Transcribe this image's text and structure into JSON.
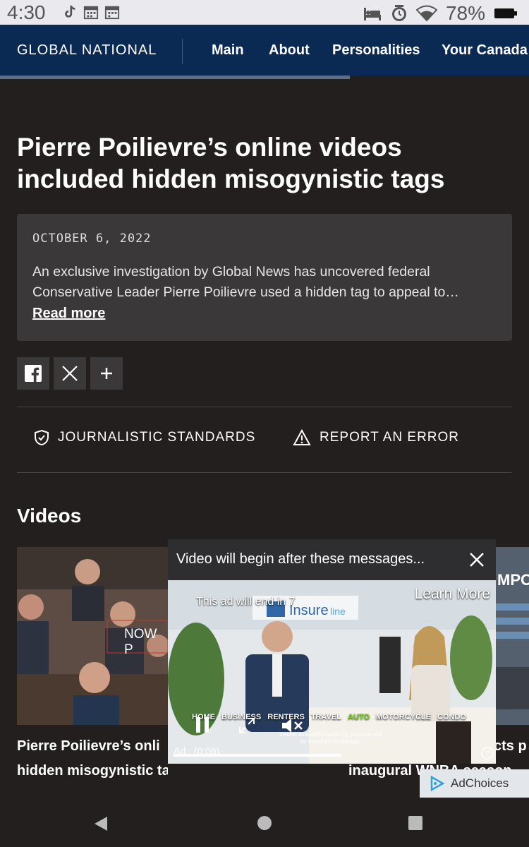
{
  "status_bar": {
    "time": "4:30",
    "battery": "78%",
    "left_icons": [
      "tiktok-icon",
      "calendar-icon",
      "calendar-icon"
    ],
    "right_icons": [
      "bed-icon",
      "alarm-icon",
      "wifi-icon",
      "battery-icon"
    ]
  },
  "navbar": {
    "brand": "GLOBAL NATIONAL",
    "items": [
      "Main",
      "About",
      "Personalities",
      "Your Canada"
    ],
    "bg_color": "#0b2a53"
  },
  "article": {
    "headline": "Pierre Poilievre’s online videos included hidden misogynistic tags",
    "date": "OCTOBER 6, 2022",
    "summary": "An exclusive investigation by Global News has uncovered federal Conservative Leader Pierre Poilievre used a hidden tag to appeal to…",
    "read_more": "Read more"
  },
  "share": {
    "icons": [
      "facebook-icon",
      "x-icon",
      "plus-icon"
    ]
  },
  "standards": {
    "journalistic": "JOURNALISTIC STANDARDS",
    "report": "REPORT AN ERROR"
  },
  "videos": {
    "title": "Videos",
    "items": [
      {
        "caption_line1": "Pierre Poilievre’s onli",
        "caption_line2": "hidden misogynistic tags",
        "overlay": "NOW P"
      },
      {
        "caption_line1": "cts p",
        "caption_line2": "inaugural WNBA season",
        "overlay": "MPO"
      }
    ]
  },
  "ad": {
    "header": "Video will begin after these messages...",
    "learn_more": "Learn More",
    "countdown": "This ad will end in 7",
    "brand": "Insureline",
    "categories": [
      "HOME",
      "BUSINESS",
      "RENTERS",
      "TRAVEL",
      "AUTO",
      "MOTORCYCLE",
      "CONDO"
    ],
    "highlight_category": "AUTO",
    "disclaimer": "Insurer availability varies by province and by Insureline brokerage.",
    "time": "Ad : (0:06)",
    "progress": 0.53
  },
  "adchoices": {
    "label": "AdChoices"
  }
}
